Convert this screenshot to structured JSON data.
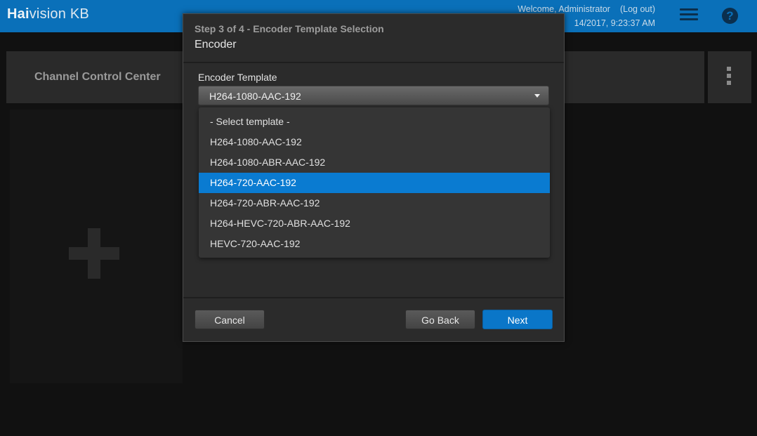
{
  "header": {
    "brand_bold": "Hai",
    "brand_rest": "vision KB",
    "welcome": "Welcome, Administrator",
    "logout": "(Log out)",
    "datetime": "14/2017, 9:23:37 AM"
  },
  "channel_control": {
    "title": "Channel Control Center"
  },
  "dialog": {
    "step": "Step 3 of 4 - Encoder Template Selection",
    "title": "Encoder",
    "field_label": "Encoder Template",
    "selected_value": "H264-1080-AAC-192",
    "options": [
      {
        "label": "- Select template -"
      },
      {
        "label": "H264-1080-AAC-192"
      },
      {
        "label": "H264-1080-ABR-AAC-192"
      },
      {
        "label": "H264-720-AAC-192"
      },
      {
        "label": "H264-720-ABR-AAC-192"
      },
      {
        "label": "H264-HEVC-720-ABR-AAC-192"
      },
      {
        "label": "HEVC-720-AAC-192"
      }
    ],
    "highlighted_option": "H264-720-AAC-192",
    "buttons": {
      "cancel": "Cancel",
      "back": "Go Back",
      "next": "Next"
    }
  },
  "colors": {
    "accent": "#0a70b9",
    "highlight": "#0a7bd1",
    "background": "#111111"
  },
  "icons": {
    "menu": "hamburger-menu-icon",
    "help": "help-icon",
    "more": "kebab-menu-icon",
    "add": "plus-icon"
  }
}
